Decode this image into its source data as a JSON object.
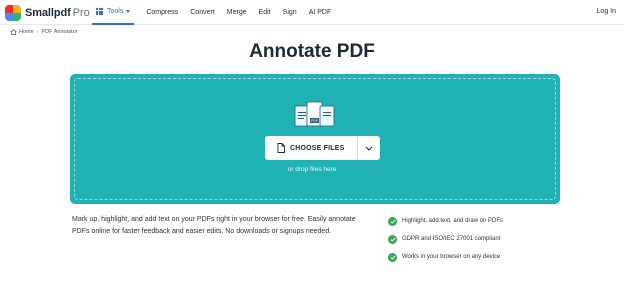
{
  "header": {
    "logo_text": "Smallpdf",
    "logo_pro": "Pro",
    "nav": {
      "tools": "Tools",
      "items": [
        "Compress",
        "Convert",
        "Merge",
        "Edit",
        "Sign",
        "AI PDF"
      ]
    },
    "login": "Log In"
  },
  "breadcrumb": {
    "home": "Home",
    "current": "PDF Annotator"
  },
  "page_title": "Annotate PDF",
  "dropzone": {
    "choose_files": "CHOOSE FILES",
    "drop_text": "or drop files here",
    "accent_color": "#1fb1b4"
  },
  "description": "Mark up, highlight, and add text on your PDFs right in your browser for free. Easily annotate PDFs online for faster feedback and easier edits. No downloads or signups needed.",
  "features": [
    "Highlight, add text, and draw on PDFs",
    "GDPR and ISO/IEC 27001 compliant",
    "Works in your browser on any device"
  ],
  "icons": {
    "logo": "smallpdf-logo-icon",
    "tools": "grid-icon",
    "home": "home-icon",
    "files": "pdf-files-icon",
    "choose": "document-icon",
    "dropdown": "chevron-down-icon",
    "feature": "check-circle-icon"
  }
}
